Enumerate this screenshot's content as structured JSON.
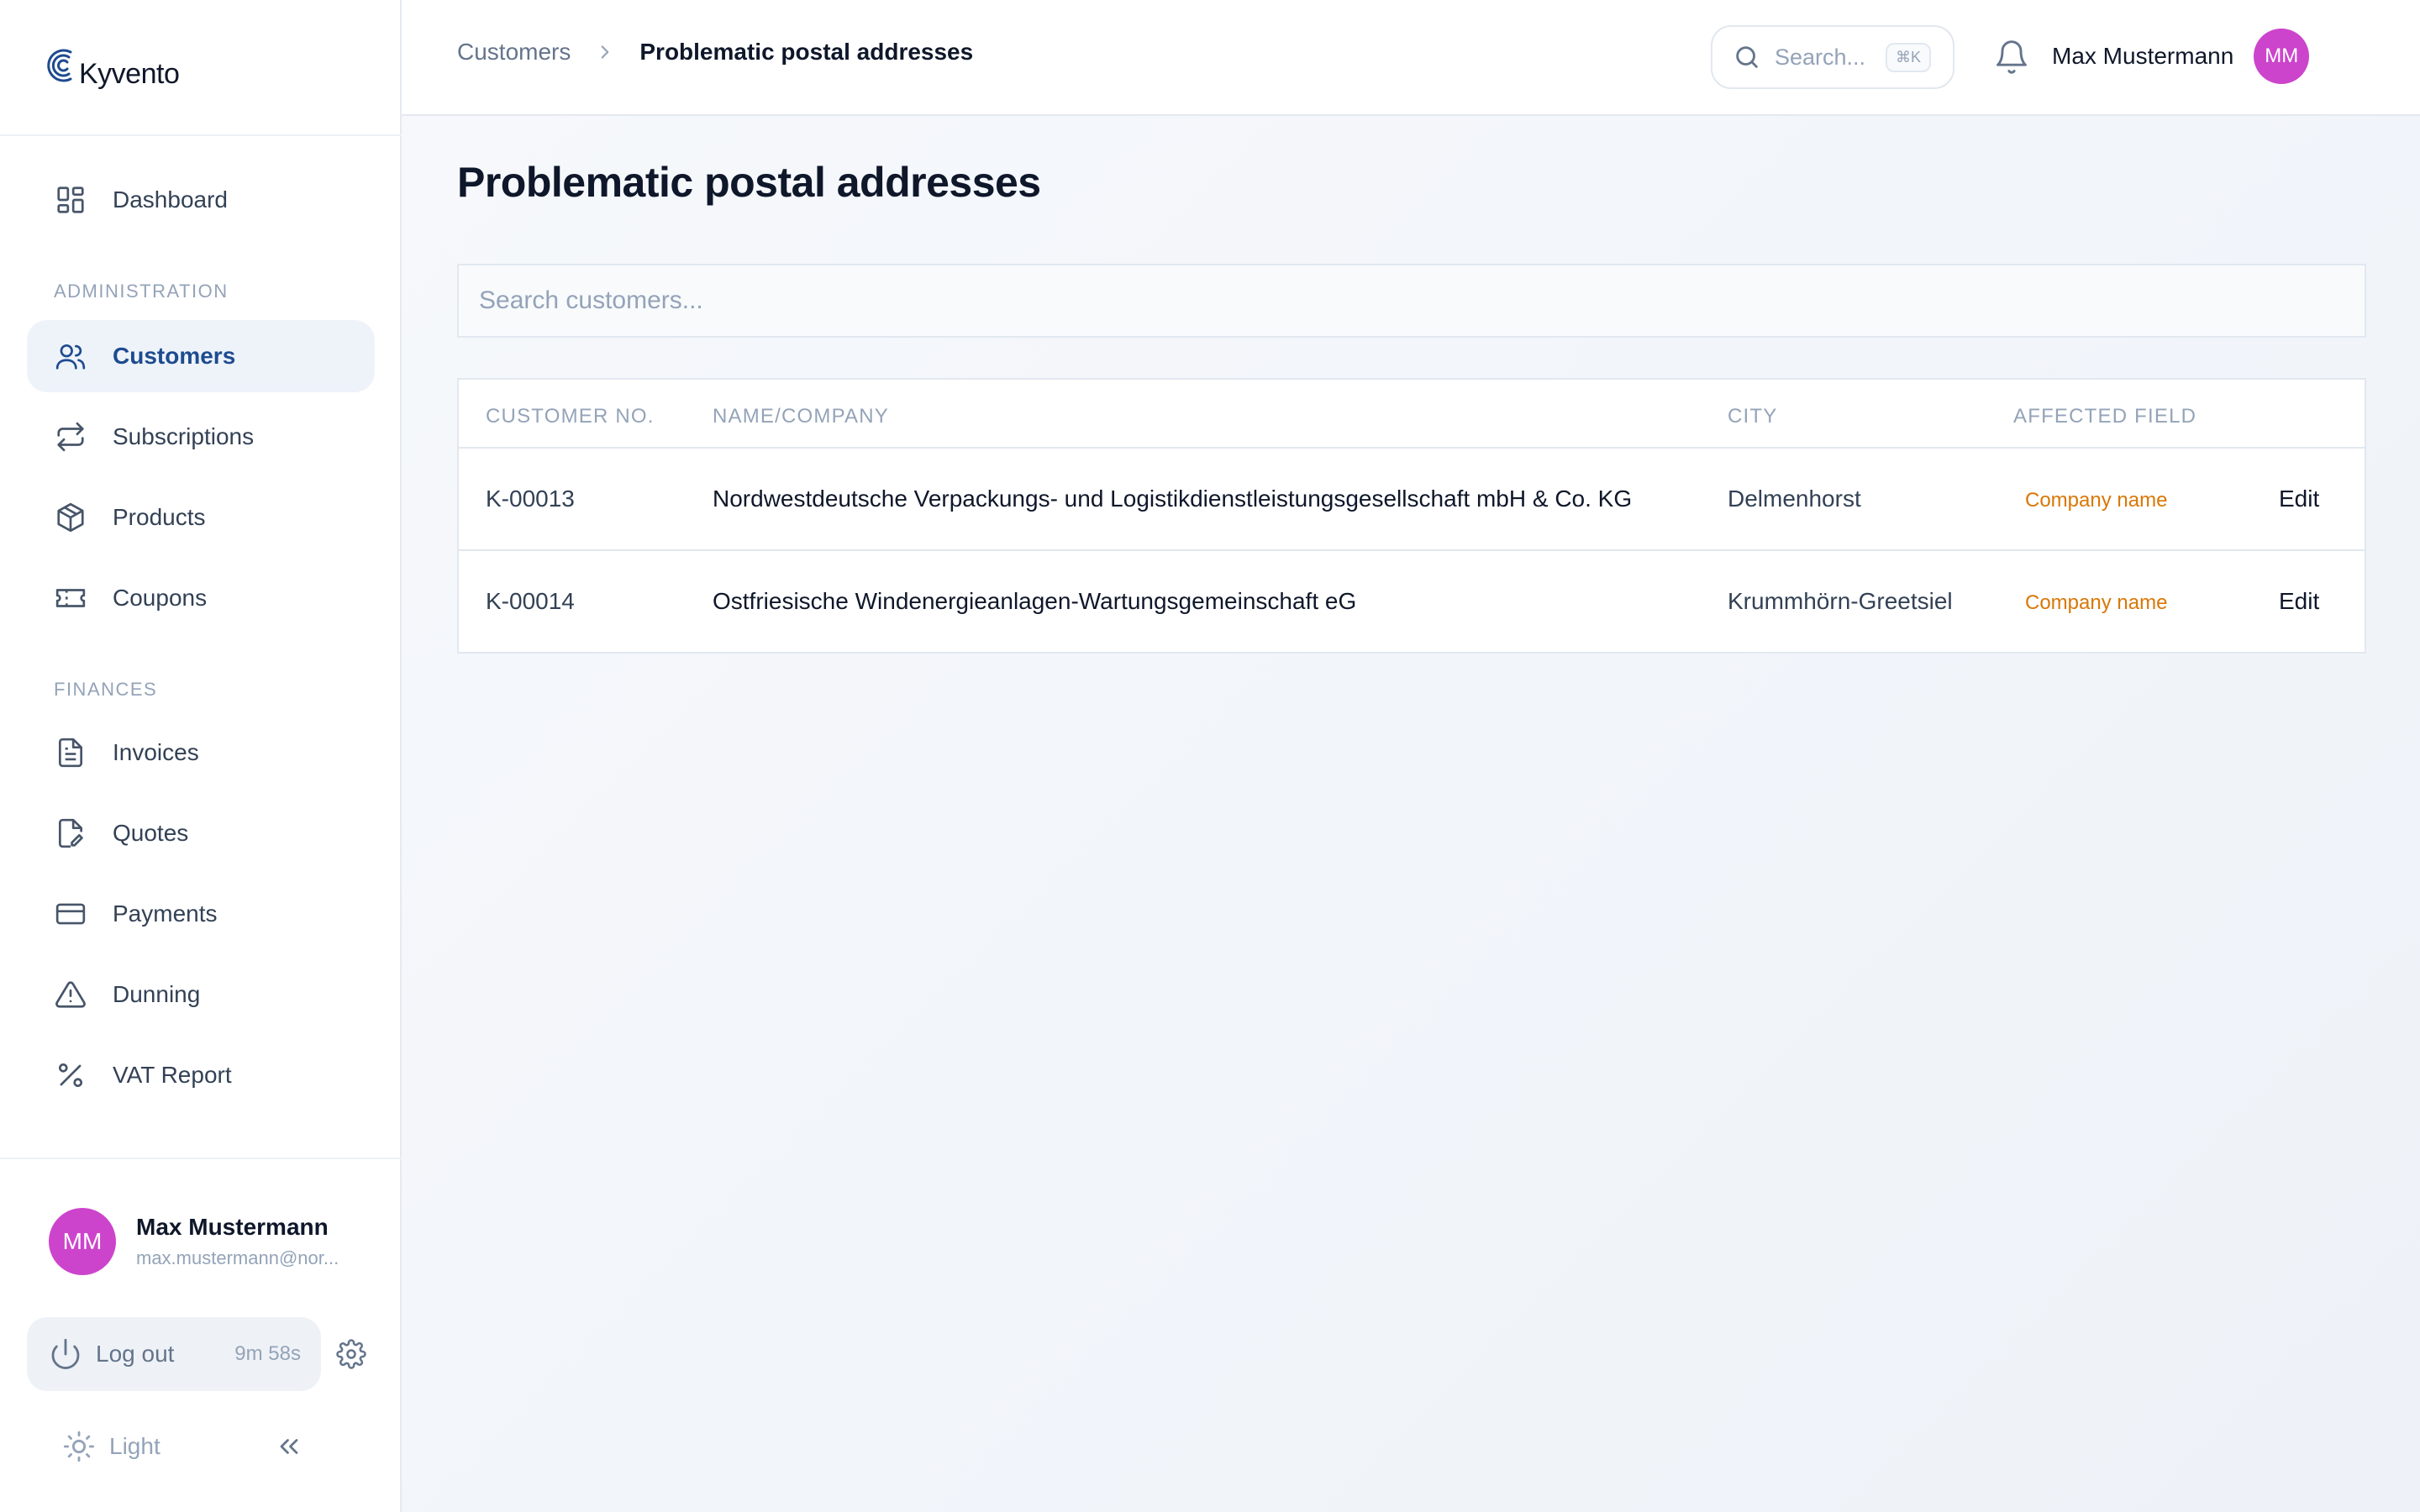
{
  "brand": {
    "name": "Kyvento"
  },
  "sidebar": {
    "dashboard": "Dashboard",
    "sections": {
      "administration": "ADMINISTRATION",
      "finances": "FINANCES"
    },
    "administration_items": [
      {
        "label": "Customers",
        "icon": "users-icon",
        "active": true
      },
      {
        "label": "Subscriptions",
        "icon": "repeat-icon"
      },
      {
        "label": "Products",
        "icon": "box-icon"
      },
      {
        "label": "Coupons",
        "icon": "ticket-icon"
      }
    ],
    "finance_items": [
      {
        "label": "Invoices",
        "icon": "file-text-icon"
      },
      {
        "label": "Quotes",
        "icon": "file-edit-icon"
      },
      {
        "label": "Payments",
        "icon": "credit-card-icon"
      },
      {
        "label": "Dunning",
        "icon": "alert-triangle-icon"
      },
      {
        "label": "VAT Report",
        "icon": "percent-icon"
      }
    ],
    "user": {
      "initials": "MM",
      "name": "Max Mustermann",
      "email": "max.mustermann@nor..."
    },
    "logout": {
      "label": "Log out",
      "timer": "9m 58s"
    },
    "theme": "Light"
  },
  "topbar": {
    "breadcrumb": {
      "parent": "Customers",
      "current": "Problematic postal addresses"
    },
    "search": {
      "placeholder": "Search...",
      "shortcut": "⌘K"
    },
    "user": {
      "name": "Max Mustermann",
      "initials": "MM"
    }
  },
  "main": {
    "title": "Problematic postal addresses",
    "search_placeholder": "Search customers...",
    "table": {
      "headers": {
        "customer_no": "CUSTOMER NO.",
        "name": "NAME/COMPANY",
        "city": "CITY",
        "field": "AFFECTED FIELD"
      },
      "rows": [
        {
          "customer_no": "K-00013",
          "name": "Nordwestdeutsche Verpackungs- und Logistikdienstleistungsgesellschaft mbH & Co. KG",
          "city": "Delmenhorst",
          "field": "Company name",
          "action": "Edit"
        },
        {
          "customer_no": "K-00014",
          "name": "Ostfriesische Windenergieanlagen-Wartungsgemeinschaft eG",
          "city": "Krummhörn-Greetsiel",
          "field": "Company name",
          "action": "Edit"
        }
      ]
    }
  },
  "colors": {
    "accent": "#1e4b8f",
    "avatar": "#cc44cc",
    "warning_tag": "#d97706"
  }
}
